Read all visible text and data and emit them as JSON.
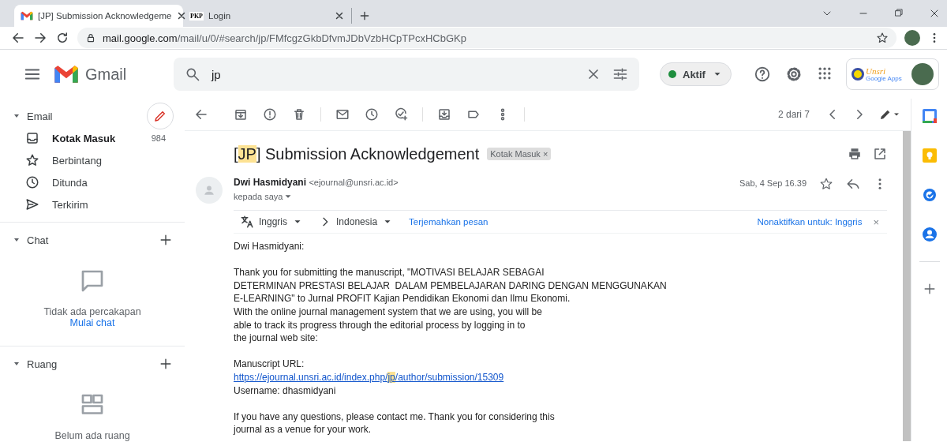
{
  "browser": {
    "tabs": [
      {
        "title": "[JP] Submission Acknowledgeme",
        "kind": "gmail",
        "selected": true
      },
      {
        "title": "Login",
        "kind": "text",
        "favicon_text": "PKP",
        "selected": false
      }
    ],
    "url": {
      "host": "mail.google.com",
      "path": "/mail/u/0/#search/jp/FMfcgzGkbDfvmJDbVzbHCpTPcxHCbGKp"
    }
  },
  "header": {
    "app_name": "Gmail",
    "search": {
      "value": "jp"
    },
    "status": {
      "label": "Aktif"
    },
    "account_logo": {
      "title": "Unsri",
      "subtitle": "Google Apps"
    }
  },
  "sidebar": {
    "sections": [
      {
        "kind": "mail",
        "title": "Email",
        "expanded": true,
        "items": [
          {
            "kind": "inbox",
            "label": "Kotak Masuk",
            "count": "984",
            "unread": true
          },
          {
            "kind": "starred",
            "label": "Berbintang",
            "unread": false
          },
          {
            "kind": "snoozed",
            "label": "Ditunda",
            "unread": false
          },
          {
            "kind": "sent",
            "label": "Terkirim",
            "unread": false
          }
        ]
      },
      {
        "kind": "chat",
        "title": "Chat",
        "expanded": true,
        "empty_text": "Tidak ada percakapan",
        "action": "Mulai chat"
      },
      {
        "kind": "rooms",
        "title": "Ruang",
        "expanded": true,
        "empty_text": "Belum ada ruang"
      }
    ]
  },
  "toolbar": {
    "position": "2 dari 7"
  },
  "message": {
    "subject": [
      {
        "text": "[",
        "highlight": false
      },
      {
        "text": "JP",
        "highlight": true
      },
      {
        "text": "] Submission Acknowledgement",
        "highlight": false
      }
    ],
    "label": {
      "text": "Kotak Masuk",
      "close": "×"
    },
    "sender": {
      "name": "Dwi Hasmidyani",
      "email": "<ejournal@unsri.ac.id>",
      "recipient": "kepada saya",
      "date": "Sab, 4 Sep 16.39"
    },
    "translation": {
      "from": "Inggris",
      "to": "Indonesia",
      "action": "Terjemahkan pesan",
      "disable": "Nonaktifkan untuk: Inggris",
      "close": "×"
    },
    "body": [
      {
        "blocks": [
          {
            "kind": "text",
            "lines": [
              "Dwi Hasmidyani:"
            ]
          }
        ]
      },
      {
        "blocks": [
          {
            "kind": "text",
            "lines": [
              "Thank you for submitting the manuscript, \"MOTIVASI BELAJAR SEBAGAI",
              "DETERMINAN PRESTASI BELAJAR  DALAM PEMBELAJARAN DARING DENGAN MENGGUNAKAN",
              "E-LEARNING\" to Jurnal PROFIT Kajian Pendidikan Ekonomi dan Ilmu Ekonomi.",
              "With the online journal management system that we are using, you will be",
              "able to track its progress through the editorial process by logging in to",
              "the journal web site:"
            ]
          }
        ]
      },
      {
        "blocks": [
          {
            "kind": "text",
            "lines": [
              "Manuscript URL:"
            ]
          },
          {
            "kind": "link",
            "parts": [
              {
                "text": "https://ejournal.unsri.ac.id/index.php/",
                "highlight": false
              },
              {
                "text": "jp",
                "highlight": true
              },
              {
                "text": "/author/submission/15309",
                "highlight": false
              }
            ]
          },
          {
            "kind": "text",
            "lines": [
              "Username: dhasmidyani"
            ]
          }
        ]
      },
      {
        "blocks": [
          {
            "kind": "text",
            "lines": [
              "If you have any questions, please contact me. Thank you for considering this",
              "journal as a venue for your work."
            ]
          }
        ]
      }
    ]
  }
}
